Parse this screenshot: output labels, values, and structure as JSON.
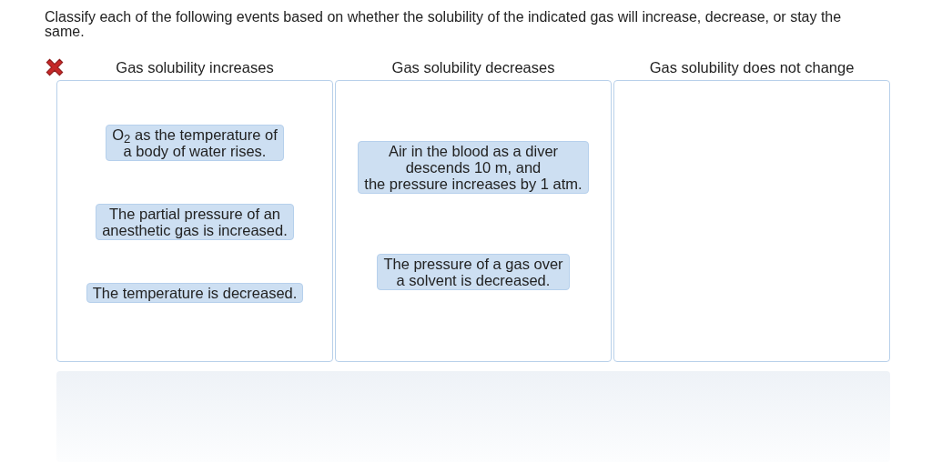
{
  "question": "Classify each of the following events based on whether the solubility of the indicated gas will increase, decrease, or stay the same.",
  "marked_wrong": true,
  "bins": [
    {
      "label": "Gas solubility increases",
      "cards": [
        {
          "lines": [
            "O$_{2}$ as the temperature of",
            "a body of water rises."
          ]
        },
        {
          "lines": [
            "The partial pressure of an",
            "anesthetic gas is increased."
          ]
        },
        {
          "lines": [
            "The temperature is decreased."
          ]
        }
      ]
    },
    {
      "label": "Gas solubility decreases",
      "cards": [
        {
          "lines": [
            "Air in the blood as a diver",
            "descends 10 m, and",
            "the pressure increases by 1 atm."
          ]
        },
        {
          "lines": [
            "The pressure of a gas over",
            "a solvent is decreased."
          ]
        }
      ]
    },
    {
      "label": "Gas solubility does not change"
    }
  ]
}
